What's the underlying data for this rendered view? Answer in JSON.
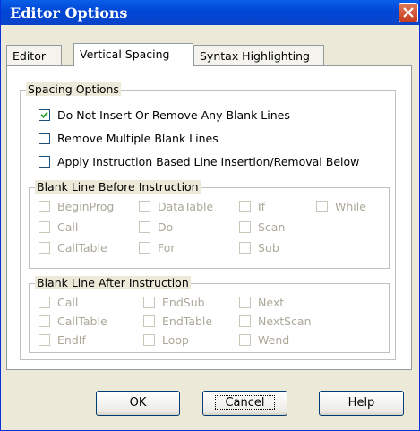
{
  "window": {
    "title": "Editor Options"
  },
  "tabs": [
    {
      "label": "Editor"
    },
    {
      "label": "Vertical Spacing",
      "selected": true
    },
    {
      "label": "Syntax Highlighting"
    }
  ],
  "spacing_options": {
    "legend": "Spacing Options",
    "items": [
      {
        "label": "Do Not Insert Or Remove Any Blank Lines",
        "checked": true
      },
      {
        "label": "Remove Multiple Blank Lines",
        "checked": false
      },
      {
        "label": "Apply Instruction Based Line Insertion/Removal Below",
        "checked": false
      }
    ]
  },
  "blank_before": {
    "legend": "Blank Line Before Instruction",
    "items": [
      "BeginProg",
      "DataTable",
      "If",
      "While",
      "Call",
      "Do",
      "Scan",
      "CallTable",
      "For",
      "Sub"
    ]
  },
  "blank_after": {
    "legend": "Blank Line After Instruction",
    "items": [
      "Call",
      "EndSub",
      "Next",
      "CallTable",
      "EndTable",
      "NextScan",
      "EndIf",
      "Loop",
      "Wend"
    ]
  },
  "buttons": {
    "ok": "OK",
    "cancel": "Cancel",
    "help": "Help"
  },
  "colors": {
    "titlebar": "#0a5fe8",
    "close": "#c53b1d",
    "dialog": "#ece9d8",
    "disabled_text": "#aca899"
  }
}
